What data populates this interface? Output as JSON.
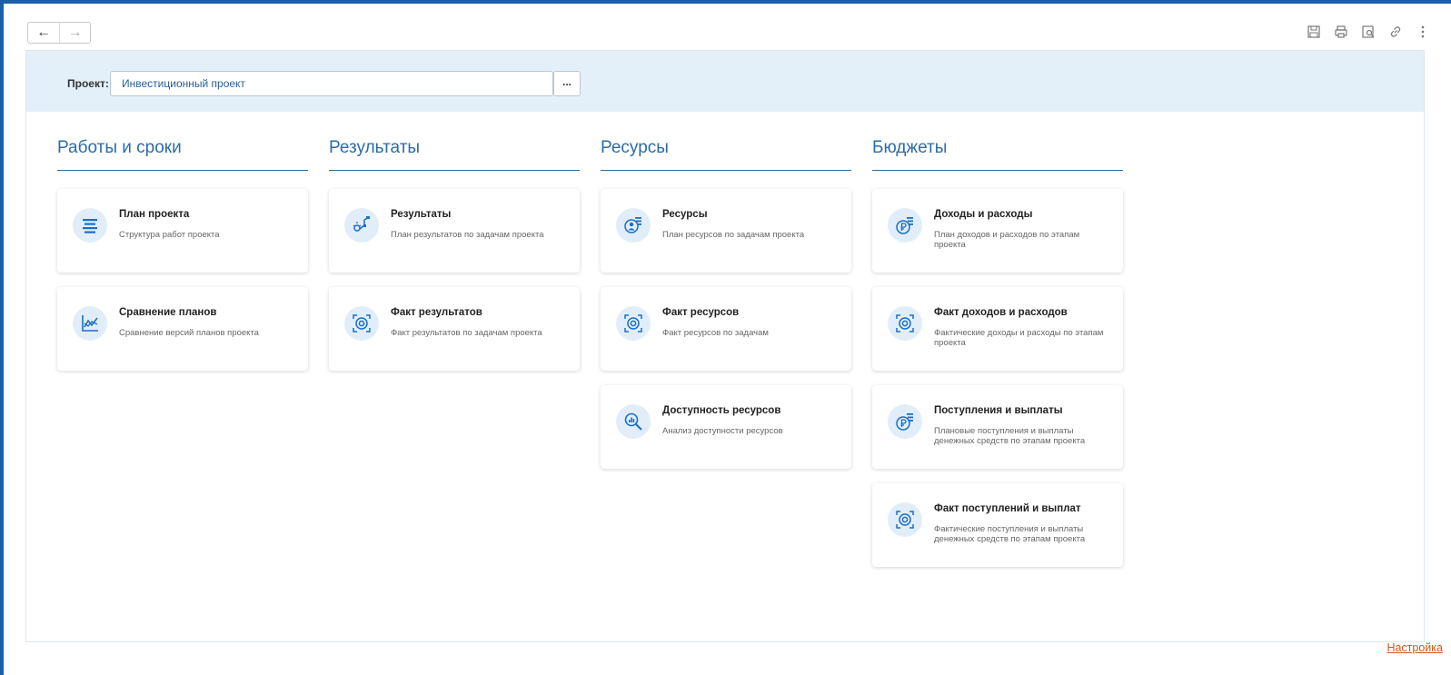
{
  "toolbar": {
    "back_icon": "arrow-left-icon",
    "forward_icon": "arrow-right-icon",
    "right_icons": [
      "save-icon",
      "print-icon",
      "preview-icon",
      "link-icon",
      "more-icon"
    ]
  },
  "project": {
    "label": "Проект:",
    "value": "Инвестиционный проект",
    "more_label": "..."
  },
  "columns": [
    {
      "title": "Работы и сроки",
      "cards": [
        {
          "title": "План проекта",
          "desc": "Структура работ проекта",
          "icon": "list-icon"
        },
        {
          "title": "Сравнение планов",
          "desc": "Сравнение версий планов проекта",
          "icon": "chart-compare-icon"
        }
      ]
    },
    {
      "title": "Результаты",
      "cards": [
        {
          "title": "Результаты",
          "desc": "План результатов по задачам проекта",
          "icon": "results-icon"
        },
        {
          "title": "Факт результатов",
          "desc": "Факт результатов по задачам проекта",
          "icon": "target-icon"
        }
      ]
    },
    {
      "title": "Ресурсы",
      "cards": [
        {
          "title": "Ресурсы",
          "desc": "План ресурсов по задачам проекта",
          "icon": "resources-icon"
        },
        {
          "title": "Факт ресурсов",
          "desc": "Факт ресурсов по задачам",
          "icon": "target-icon"
        },
        {
          "title": "Доступность ресурсов",
          "desc": "Анализ доступности ресурсов",
          "icon": "analysis-icon"
        }
      ]
    },
    {
      "title": "Бюджеты",
      "cards": [
        {
          "title": "Доходы и расходы",
          "desc": "План доходов и расходов по этапам проекта",
          "icon": "ruble-list-icon"
        },
        {
          "title": "Факт доходов и расходов",
          "desc": "Фактические доходы и расходы по этапам проекта",
          "icon": "target-icon"
        },
        {
          "title": "Поступления и выплаты",
          "desc": "Плановые поступления и выплаты денежных средств по этапам проекта",
          "icon": "ruble-list-icon"
        },
        {
          "title": "Факт поступлений и выплат",
          "desc": "Фактические поступления и выплаты денежных средств по этапам проекта",
          "icon": "target-icon"
        }
      ]
    }
  ],
  "footer": {
    "settings_label": "Настройка"
  },
  "colors": {
    "accent": "#2c6ba8",
    "frame": "#1a5fa8",
    "link": "#d05a14",
    "project_bar": "#e3f0fa"
  }
}
